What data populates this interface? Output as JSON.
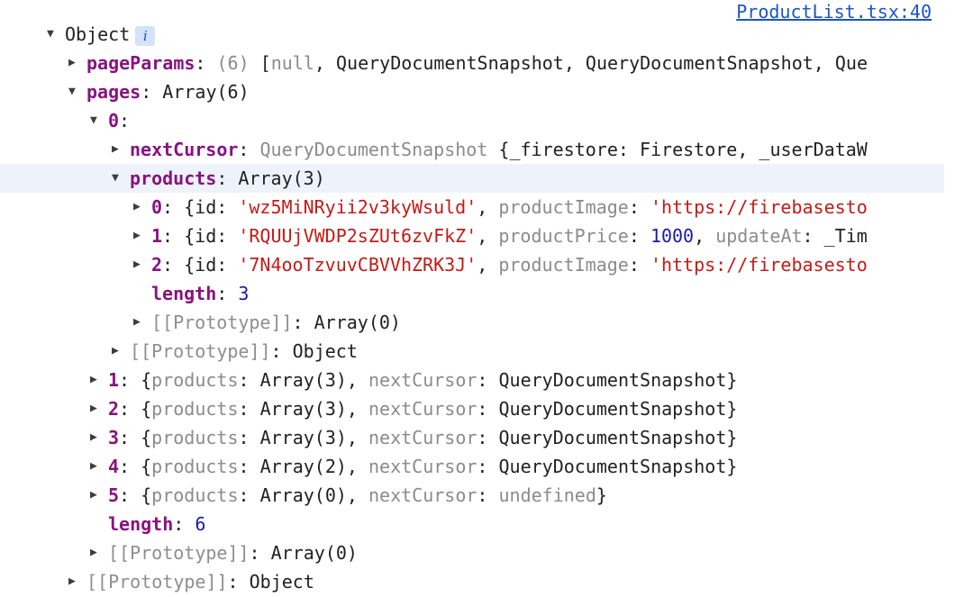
{
  "source_link": "ProductList.tsx:40",
  "rows": [
    {
      "indent": 0,
      "tri": "down",
      "name": "root-object-row",
      "badge": true,
      "parts": [
        {
          "t": "Object",
          "c": "plain"
        }
      ]
    },
    {
      "indent": 1,
      "tri": "right",
      "name": "pageParams-row",
      "parts": [
        {
          "t": "pageParams",
          "c": "key"
        },
        {
          "t": ": ",
          "c": "plain"
        },
        {
          "t": "(6) ",
          "c": "dim"
        },
        {
          "t": "[",
          "c": "plain"
        },
        {
          "t": "null",
          "c": "null"
        },
        {
          "t": ", QueryDocumentSnapshot, QueryDocumentSnapshot, Que",
          "c": "plain"
        }
      ]
    },
    {
      "indent": 1,
      "tri": "down",
      "name": "pages-row",
      "parts": [
        {
          "t": "pages",
          "c": "key"
        },
        {
          "t": ": Array(6)",
          "c": "plain"
        }
      ]
    },
    {
      "indent": 2,
      "tri": "down",
      "name": "pages-0-row",
      "parts": [
        {
          "t": "0",
          "c": "key"
        },
        {
          "t": ":",
          "c": "plain"
        }
      ]
    },
    {
      "indent": 3,
      "tri": "right",
      "name": "nextCursor-row",
      "parts": [
        {
          "t": "nextCursor",
          "c": "key"
        },
        {
          "t": ": ",
          "c": "plain"
        },
        {
          "t": "QueryDocumentSnapshot ",
          "c": "dim"
        },
        {
          "t": "{_firestore: Firestore, _userDataW",
          "c": "plain"
        }
      ]
    },
    {
      "indent": 3,
      "tri": "down",
      "name": "products-row",
      "highlight": true,
      "parts": [
        {
          "t": "products",
          "c": "key"
        },
        {
          "t": ": Array(3)",
          "c": "plain"
        }
      ]
    },
    {
      "indent": 4,
      "tri": "right",
      "name": "product-0-row",
      "parts": [
        {
          "t": "0",
          "c": "key"
        },
        {
          "t": ": {id: ",
          "c": "plain"
        },
        {
          "t": "'wz5MiNRyii2v3kyWsuld'",
          "c": "str"
        },
        {
          "t": ", ",
          "c": "plain"
        },
        {
          "t": "productImage",
          "c": "dim"
        },
        {
          "t": ": ",
          "c": "plain"
        },
        {
          "t": "'https://firebasesto",
          "c": "str"
        }
      ]
    },
    {
      "indent": 4,
      "tri": "right",
      "name": "product-1-row",
      "parts": [
        {
          "t": "1",
          "c": "key"
        },
        {
          "t": ": {id: ",
          "c": "plain"
        },
        {
          "t": "'RQUUjVWDP2sZUt6zvFkZ'",
          "c": "str"
        },
        {
          "t": ", ",
          "c": "plain"
        },
        {
          "t": "productPrice",
          "c": "dim"
        },
        {
          "t": ": ",
          "c": "plain"
        },
        {
          "t": "1000",
          "c": "num"
        },
        {
          "t": ", ",
          "c": "plain"
        },
        {
          "t": "updateAt",
          "c": "dim"
        },
        {
          "t": ": _Tim",
          "c": "plain"
        }
      ]
    },
    {
      "indent": 4,
      "tri": "right",
      "name": "product-2-row",
      "parts": [
        {
          "t": "2",
          "c": "key"
        },
        {
          "t": ": {id: ",
          "c": "plain"
        },
        {
          "t": "'7N4ooTzvuvCBVVhZRK3J'",
          "c": "str"
        },
        {
          "t": ", ",
          "c": "plain"
        },
        {
          "t": "productImage",
          "c": "dim"
        },
        {
          "t": ": ",
          "c": "plain"
        },
        {
          "t": "'https://firebasesto",
          "c": "str"
        }
      ]
    },
    {
      "indent": 4,
      "tri": "none",
      "name": "products-length-row",
      "parts": [
        {
          "t": "length",
          "c": "key"
        },
        {
          "t": ": ",
          "c": "plain"
        },
        {
          "t": "3",
          "c": "num"
        }
      ]
    },
    {
      "indent": 4,
      "tri": "right",
      "name": "products-prototype-row",
      "parts": [
        {
          "t": "[[Prototype]]",
          "c": "proto"
        },
        {
          "t": ": Array(0)",
          "c": "plain"
        }
      ]
    },
    {
      "indent": 3,
      "tri": "right",
      "name": "page0-prototype-row",
      "parts": [
        {
          "t": "[[Prototype]]",
          "c": "proto"
        },
        {
          "t": ": Object",
          "c": "plain"
        }
      ]
    },
    {
      "indent": 2,
      "tri": "right",
      "name": "pages-1-row",
      "parts": [
        {
          "t": "1",
          "c": "key"
        },
        {
          "t": ": {",
          "c": "plain"
        },
        {
          "t": "products",
          "c": "dim"
        },
        {
          "t": ": Array(3), ",
          "c": "plain"
        },
        {
          "t": "nextCursor",
          "c": "dim"
        },
        {
          "t": ": QueryDocumentSnapshot}",
          "c": "plain"
        }
      ]
    },
    {
      "indent": 2,
      "tri": "right",
      "name": "pages-2-row",
      "parts": [
        {
          "t": "2",
          "c": "key"
        },
        {
          "t": ": {",
          "c": "plain"
        },
        {
          "t": "products",
          "c": "dim"
        },
        {
          "t": ": Array(3), ",
          "c": "plain"
        },
        {
          "t": "nextCursor",
          "c": "dim"
        },
        {
          "t": ": QueryDocumentSnapshot}",
          "c": "plain"
        }
      ]
    },
    {
      "indent": 2,
      "tri": "right",
      "name": "pages-3-row",
      "parts": [
        {
          "t": "3",
          "c": "key"
        },
        {
          "t": ": {",
          "c": "plain"
        },
        {
          "t": "products",
          "c": "dim"
        },
        {
          "t": ": Array(3), ",
          "c": "plain"
        },
        {
          "t": "nextCursor",
          "c": "dim"
        },
        {
          "t": ": QueryDocumentSnapshot}",
          "c": "plain"
        }
      ]
    },
    {
      "indent": 2,
      "tri": "right",
      "name": "pages-4-row",
      "parts": [
        {
          "t": "4",
          "c": "key"
        },
        {
          "t": ": {",
          "c": "plain"
        },
        {
          "t": "products",
          "c": "dim"
        },
        {
          "t": ": Array(2), ",
          "c": "plain"
        },
        {
          "t": "nextCursor",
          "c": "dim"
        },
        {
          "t": ": QueryDocumentSnapshot}",
          "c": "plain"
        }
      ]
    },
    {
      "indent": 2,
      "tri": "right",
      "name": "pages-5-row",
      "parts": [
        {
          "t": "5",
          "c": "key"
        },
        {
          "t": ": {",
          "c": "plain"
        },
        {
          "t": "products",
          "c": "dim"
        },
        {
          "t": ": Array(0), ",
          "c": "plain"
        },
        {
          "t": "nextCursor",
          "c": "dim"
        },
        {
          "t": ": ",
          "c": "plain"
        },
        {
          "t": "undefined",
          "c": "null"
        },
        {
          "t": "}",
          "c": "plain"
        }
      ]
    },
    {
      "indent": 2,
      "tri": "none",
      "name": "pages-length-row",
      "parts": [
        {
          "t": "length",
          "c": "key"
        },
        {
          "t": ": ",
          "c": "plain"
        },
        {
          "t": "6",
          "c": "num"
        }
      ]
    },
    {
      "indent": 2,
      "tri": "right",
      "name": "pages-prototype-row",
      "parts": [
        {
          "t": "[[Prototype]]",
          "c": "proto"
        },
        {
          "t": ": Array(0)",
          "c": "plain"
        }
      ]
    },
    {
      "indent": 1,
      "tri": "right",
      "name": "root-prototype-row",
      "parts": [
        {
          "t": "[[Prototype]]",
          "c": "proto"
        },
        {
          "t": ": Object",
          "c": "plain"
        }
      ]
    }
  ],
  "badge_text": "i",
  "colors": {
    "key": "#881280",
    "string": "#c41a16",
    "number": "#1a1aa6",
    "dim": "#8b8b8b",
    "link": "#1a55c7"
  },
  "icons": {
    "expanded": "triangle-down-icon",
    "collapsed": "triangle-right-icon",
    "info": "info-icon"
  }
}
